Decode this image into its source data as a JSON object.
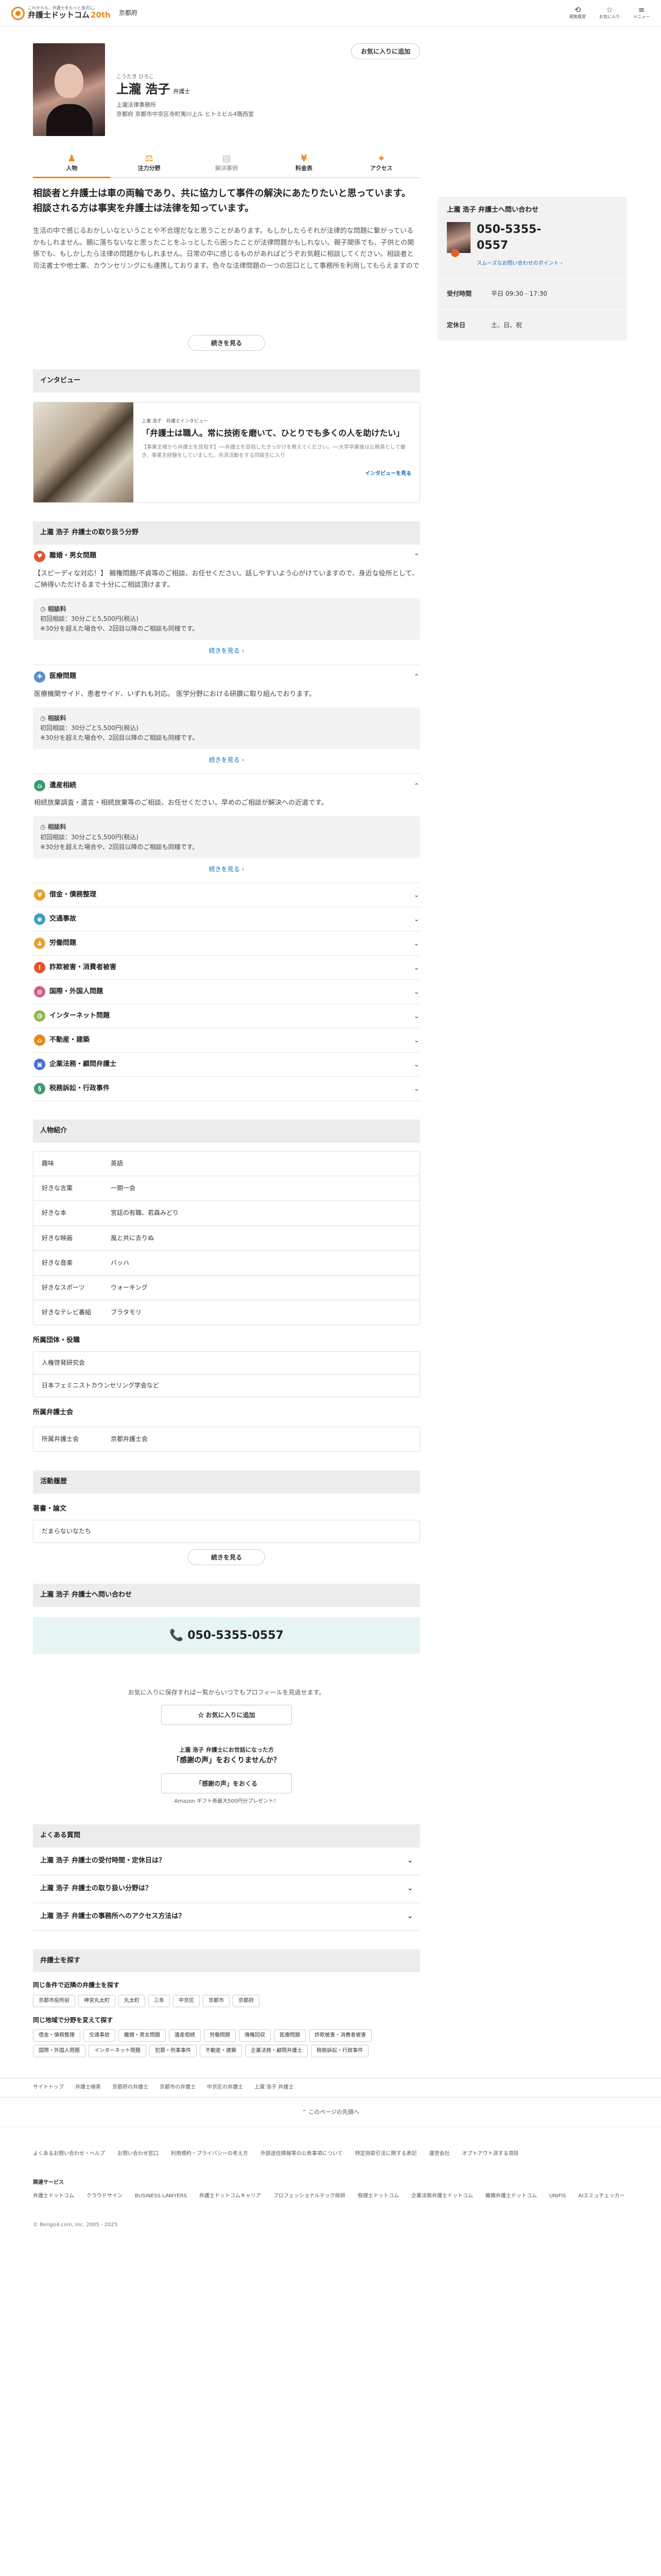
{
  "header": {
    "tagline": "これからも、弁護士をもっと身近に。",
    "site_name": "弁護士ドットコム",
    "anniversary": "20th",
    "prefecture": "京都府",
    "icons": [
      {
        "label": "閲覧履歴",
        "glyph": "⟲"
      },
      {
        "label": "お気に入り",
        "glyph": "☆"
      },
      {
        "label": "メニュー",
        "glyph": "≡"
      }
    ]
  },
  "profile": {
    "kana": "こうたき ひろこ",
    "name": "上瀧 浩子",
    "title": "弁護士",
    "firm": "上瀧法律事務所",
    "address": "京都府 京都市中京区寺町夷川上ル ヒトミビル4階西室",
    "fav_button": "お気に入りに追加"
  },
  "tabs": [
    {
      "label": "人物",
      "icon": "♟"
    },
    {
      "label": "注力分野",
      "icon": "⚖"
    },
    {
      "label": "解決事例",
      "icon": "▤"
    },
    {
      "label": "料金表",
      "icon": "¥"
    },
    {
      "label": "アクセス",
      "icon": "⌖"
    }
  ],
  "intro": {
    "lead": "相談者と弁護士は車の両輪であり、共に協力して事件の解決にあたりたいと思っています。 相談される方は事実を弁護士は法律を知っています。",
    "body": "生活の中で感じるおかしいなということや不合理だなと思うことがあります。もしかしたらそれが法律的な問題に繋がっているかもしれません。願に落ちないなと思ったことをふっとしたら困ったことが法律問題かもしれない。親子関係でも、子供との関係でも、もしかしたら法律の問題かもしれません。日常の中に感じるものがあればどうぞお気軽に相談してください。相談者と司法書士や他士業、カウンセリングにも連携しております。色々な法律問題の一つの窓口として事務所を利用してもらえますので",
    "more": "続きを見る"
  },
  "interview": {
    "section_title": "インタビュー",
    "tag": "上瀧 浩子　弁護士インタビュー",
    "title": "「弁護士は職人。常に技術を磨いて、ひとりでも多くの人を助けたい」",
    "text": "【事業主様から弁護士を目指す】──弁護士を目指したきっかけを教えてください。──大学卒業後は公務員として働き、事業主経験をしていました。共済活動をする同級生に入り",
    "link": "インタビューを見る"
  },
  "fields": {
    "section_title": "上瀧 浩子 弁護士の取り扱う分野",
    "fee_label": "相談料",
    "expanded": [
      {
        "name": "離婚・男女問題",
        "color": "#e2562e",
        "glyph": "♥",
        "desc": "【スピーディな対応！】 親権問題/不貞等のご相談、お任せください。話しやすいよう心がけていますので、身近な役所として、ご納得いただけるまで十分にご相談頂けます。",
        "fee_lines": [
          "初回相談：30分ごと5,500円(税込)",
          "※30分を超えた場合や、2回目以降のご相談も同様です。"
        ],
        "more": "続きを見る"
      },
      {
        "name": "医療問題",
        "color": "#5a8fd0",
        "glyph": "✚",
        "desc": "医療機関サイド、患者サイド、いずれも対応。 医学分野における研鑽に取り組んでおります。",
        "fee_lines": [
          "初回相談：30分ごと5,500円(税込)",
          "※30分を超えた場合や、2回目以降のご相談も同様です。"
        ],
        "more": "続きを見る"
      },
      {
        "name": "遺産相続",
        "color": "#3f9a6f",
        "glyph": "⌂",
        "desc": "相続放棄調査・遺言・相続放棄等のご相談、お任せください。早めのご相談が解決への近道です。",
        "fee_lines": [
          "初回相談：30分ごと5,500円(税込)",
          "※30分を超えた場合や、2回目以降のご相談も同様です。"
        ],
        "more": "続きを見る"
      }
    ],
    "collapsed": [
      {
        "name": "借金・債務整理",
        "color": "#e8a030",
        "glyph": "¥"
      },
      {
        "name": "交通事故",
        "color": "#3c9bb8",
        "glyph": "◉"
      },
      {
        "name": "労働問題",
        "color": "#e8a030",
        "glyph": "♟"
      },
      {
        "name": "詐欺被害・消費者被害",
        "color": "#e2562e",
        "glyph": "!"
      },
      {
        "name": "国際・外国人問題",
        "color": "#d25a8a",
        "glyph": "◍"
      },
      {
        "name": "インターネット問題",
        "color": "#8ab84a",
        "glyph": "@"
      },
      {
        "name": "不動産・建築",
        "color": "#e8891a",
        "glyph": "⌂"
      },
      {
        "name": "企業法務・顧問弁護士",
        "color": "#3f6fd0",
        "glyph": "▣"
      },
      {
        "name": "税務訴訟・行政事件",
        "color": "#3f9a6f",
        "glyph": "§"
      }
    ]
  },
  "person": {
    "section_title": "人物紹介",
    "rows": [
      {
        "k": "趣味",
        "v": "英語"
      },
      {
        "k": "好きな言葉",
        "v": "一期一会"
      },
      {
        "k": "好きな本",
        "v": "宮廷の有職、若森みどり"
      },
      {
        "k": "好きな映画",
        "v": "風と共に去りぬ"
      },
      {
        "k": "好きな音楽",
        "v": "バッハ"
      },
      {
        "k": "好きなスポーツ",
        "v": "ウォーキング"
      },
      {
        "k": "好きなテレビ番組",
        "v": "ブラタモリ"
      }
    ],
    "groups_title": "所属団体・役職",
    "groups": [
      "人権啓発研究会",
      "日本フェミニストカウンセリング学会など"
    ],
    "bar_title": "所属弁護士会",
    "bar_k": "所属弁護士会",
    "bar_v": "京都弁護士会"
  },
  "activity": {
    "section_title": "活動履歴",
    "sub": "著書・論文",
    "items": [
      "だまらないなたち"
    ],
    "more": "続きを見る"
  },
  "contact": {
    "section_title": "上瀧 浩子 弁護士へ問い合わせ",
    "phone": "050-5355-0557"
  },
  "side": {
    "title": "上瀧 浩子 弁護士へ問い合わせ",
    "phone_line1": "050-5355-",
    "phone_line2": "0557",
    "tip": "スムーズなお問い合わせのポイント",
    "hours_k": "受付時間",
    "hours_v": "平日 09:30 - 17:30",
    "holiday_k": "定休日",
    "holiday_v": "土、日、祝"
  },
  "favorite": {
    "note": "お気に入りに保存すれば一覧からいつでもプロフィールを見返せます。",
    "button": "お気に入りに追加"
  },
  "voice": {
    "note": "上瀧 浩子 弁護士にお世話になった方",
    "title": "「感謝の声」をおくりませんか？",
    "button": "「感謝の声」をおくる",
    "gift": "Amazon ギフト券最大500円分プレゼント！"
  },
  "faq": {
    "section_title": "よくある質問",
    "items": [
      "上瀧 浩子 弁護士の受付時間・定休日は？",
      "上瀧 浩子 弁護士の取り扱い分野は？",
      "上瀧 浩子 弁護士の事務所へのアクセス方法は？"
    ]
  },
  "find": {
    "section_title": "弁護士を探す",
    "area_title": "同じ条件で近隣の弁護士を探す",
    "areas": [
      "京都市役所前",
      "神宮丸太町",
      "丸太町",
      "三条",
      "中京区",
      "京都市",
      "京都府"
    ],
    "field_title": "同じ地域で分野を変えて探す",
    "fields": [
      "借金・債務整理",
      "交通事故",
      "離婚・男女問題",
      "遺産相続",
      "労働問題",
      "債権回収",
      "医療問題",
      "詐欺被害・消費者被害",
      "国際・外国人問題",
      "インターネット問題",
      "犯罪・刑事事件",
      "不動産・建築",
      "企業法務・顧問弁護士",
      "税務訴訟・行政事件"
    ]
  },
  "breadcrumb": [
    "サイトトップ",
    "弁護士検索",
    "京都府の弁護士",
    "京都市の弁護士",
    "中京区の弁護士",
    "上瀧 浩子 弁護士"
  ],
  "footer": {
    "totop": "このページの先頭へ",
    "links": [
      "よくあるお問い合わせ・ヘルプ",
      "お問い合わせ窓口",
      "利用規約・プライバシーの考え方",
      "外部送信情報等の公表事項について",
      "特定商取引法に関する表記",
      "運営会社",
      "オプトアウト済する項目"
    ],
    "svc_title": "関連サービス",
    "svcs": [
      "弁護士ドットコム",
      "クラウドサイン",
      "BUSINESS LAWYERS",
      "弁護士ドットコムキャリア",
      "プロフェッショナルテック総研",
      "税理士ドットコム",
      "企業法務弁護士ドットコム",
      "離婚弁護士ドットコム",
      "UNIFIS",
      "AIエミュチェッカー"
    ],
    "copyright": "© Bengo4.com, Inc. 2005 - 2025"
  }
}
